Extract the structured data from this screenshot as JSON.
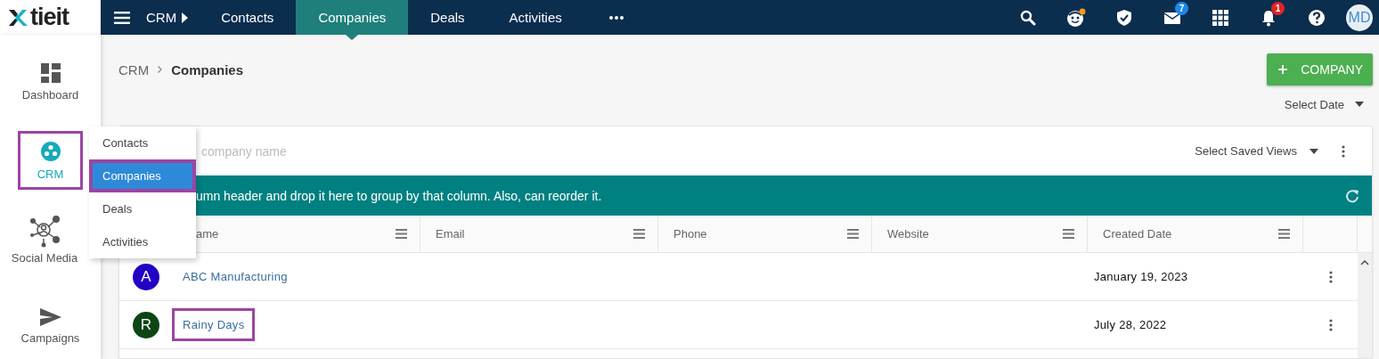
{
  "logo": {
    "text": "tieit"
  },
  "topbar": {
    "module": "CRM",
    "tabs": [
      {
        "label": "Contacts",
        "selected": false
      },
      {
        "label": "Companies",
        "selected": true
      },
      {
        "label": "Deals",
        "selected": false
      },
      {
        "label": "Activities",
        "selected": false
      }
    ],
    "icons": [
      {
        "kind": "search"
      },
      {
        "kind": "face"
      },
      {
        "kind": "shield"
      },
      {
        "kind": "mail",
        "badge": "7"
      },
      {
        "kind": "apps"
      },
      {
        "kind": "bell",
        "badge": "1"
      },
      {
        "kind": "help"
      }
    ],
    "avatar": "MD"
  },
  "sidebar": {
    "items": [
      {
        "label": "Dashboard",
        "kind": "dashboard",
        "selected": false,
        "highlighted": false
      },
      {
        "label": "CRM",
        "kind": "crm",
        "selected": true,
        "highlighted": true
      },
      {
        "label": "Social Media",
        "kind": "social",
        "selected": false,
        "highlighted": false
      },
      {
        "label": "Campaigns",
        "kind": "campaigns",
        "selected": false,
        "highlighted": false
      }
    ]
  },
  "flyout": {
    "items": [
      {
        "label": "Contacts",
        "selected": false,
        "highlighted": false
      },
      {
        "label": "Companies",
        "selected": true,
        "highlighted": true
      },
      {
        "label": "Deals",
        "selected": false,
        "highlighted": false
      },
      {
        "label": "Activities",
        "selected": false,
        "highlighted": false
      }
    ]
  },
  "breadcrumb": [
    "CRM",
    "Companies"
  ],
  "add_button": "COMPANY",
  "date_filter": "Select Date",
  "grid": {
    "search": {
      "placeholder": "company name"
    },
    "saved_views": "Select Saved Views",
    "group_banner": "umn header and drop it here to group by that column. Also, can reorder it.",
    "columns": [
      "ame",
      "Email",
      "Phone",
      "Website",
      "Created Date"
    ],
    "rows": [
      {
        "avatar": "A",
        "color": "#2200c4",
        "name": "ABC Manufacturing",
        "created": "January 19, 2023",
        "highlighted": false
      },
      {
        "avatar": "R",
        "color": "#0e4515",
        "name": "Rainy Days",
        "created": "July 28, 2022",
        "highlighted": true
      }
    ]
  }
}
